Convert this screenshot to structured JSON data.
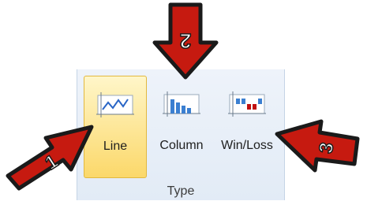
{
  "ribbon": {
    "group_label": "Type",
    "buttons": [
      {
        "label": "Line",
        "icon": "sparkline-line-icon",
        "selected": true
      },
      {
        "label": "Column",
        "icon": "sparkline-column-icon",
        "selected": false
      },
      {
        "label": "Win/Loss",
        "icon": "sparkline-winloss-icon",
        "selected": false
      }
    ]
  },
  "callouts": [
    "1",
    "2",
    "3"
  ],
  "colors": {
    "callout_fill": "#c61a10",
    "callout_outline": "#1a1a1a",
    "selected_fill": "#fbd86a",
    "column_bar": "#3b7fd1",
    "negative_bar": "#c01010"
  }
}
